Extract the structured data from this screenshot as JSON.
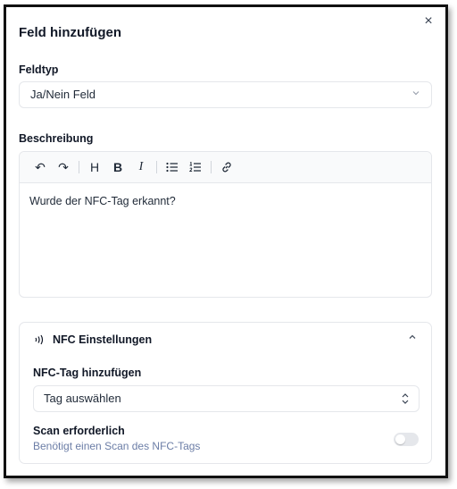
{
  "dialog": {
    "title": "Feld hinzufügen",
    "close_icon": "×"
  },
  "field_type": {
    "label": "Feldtyp",
    "value": "Ja/Nein Feld"
  },
  "description": {
    "label": "Beschreibung",
    "content": "Wurde der NFC-Tag erkannt?",
    "toolbar": {
      "undo": "↶",
      "redo": "↷",
      "heading": "H",
      "bold": "B",
      "italic": "I"
    }
  },
  "nfc": {
    "title": "NFC Einstellungen",
    "expanded": true,
    "tag_label": "NFC-Tag hinzufügen",
    "tag_value": "Tag auswählen",
    "scan_label": "Scan erforderlich",
    "scan_description": "Benötigt einen Scan des NFC-Tags",
    "scan_required": false
  },
  "colors": {
    "accent_muted": "#6b7da6",
    "border": "#e5e7eb",
    "toggle_off": "#e5e7eb"
  }
}
